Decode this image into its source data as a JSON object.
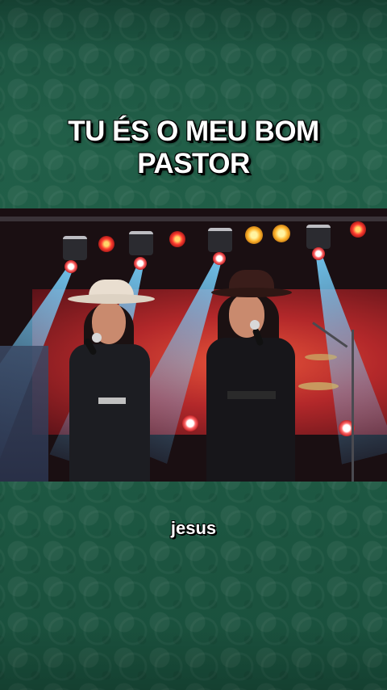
{
  "caption": {
    "line1": "TU ÉS O MEU BOM",
    "line2": "PASTOR"
  },
  "subtitle": "jesus",
  "video": {
    "description_icon": "concert-stage-video"
  },
  "colors": {
    "background": "#1d5a44",
    "text": "#ffffff",
    "text_outline": "#000000"
  }
}
